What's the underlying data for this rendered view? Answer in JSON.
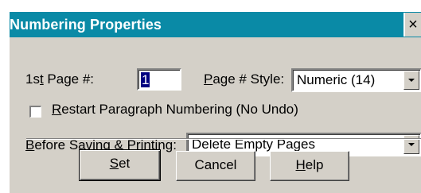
{
  "dialog": {
    "title": "Numbering Properties",
    "close_symbol": "×"
  },
  "first_page": {
    "label_pre": "1s",
    "label_accel": "t",
    "label_post": " Page #:",
    "value": "1"
  },
  "page_style": {
    "label_accel": "P",
    "label_post": "age # Style:",
    "value": "Numeric  (14)"
  },
  "restart": {
    "label_accel": "R",
    "label_post": "estart Paragraph Numbering  (No Undo)",
    "checked": false
  },
  "before_saving": {
    "label_accel": "B",
    "label_post": "efore Saving & Printing:",
    "value": "Delete Empty Pages"
  },
  "buttons": {
    "set_accel": "S",
    "set_post": "et",
    "cancel": "Cancel",
    "help_accel": "H",
    "help_post": "elp"
  },
  "colors": {
    "titlebar": "#0a8aa6",
    "face": "#d4d0c8",
    "selection": "#000080"
  },
  "icons": {
    "close": "close-icon",
    "dropdown": "chevron-down-icon"
  }
}
